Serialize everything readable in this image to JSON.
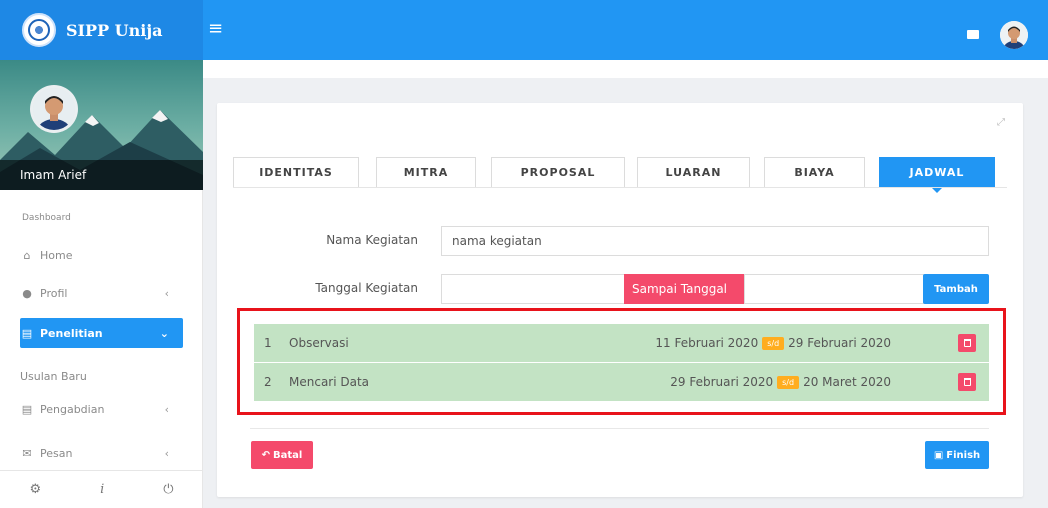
{
  "app": {
    "title": "SIPP Unija"
  },
  "topbar": {
    "menu_icon": "hamburger-icon",
    "mail_icon": "mail-icon",
    "avatar_icon": "user-avatar-icon"
  },
  "sidebar": {
    "user_name": "Imam Arief",
    "section": "Dashboard",
    "items": [
      {
        "label": "Home",
        "icon": "home-icon"
      },
      {
        "label": "Profil",
        "icon": "user-icon"
      },
      {
        "label": "Penelitian",
        "icon": "list-icon"
      },
      {
        "label": "Pengabdian",
        "icon": "list-icon"
      },
      {
        "label": "Pesan",
        "icon": "mail-icon"
      }
    ],
    "submenu": {
      "label": "Usulan Baru"
    },
    "footer": {
      "settings": "⚙",
      "info": "i",
      "power": "⏻"
    }
  },
  "tabs": [
    {
      "label": "IDENTITAS"
    },
    {
      "label": "MITRA"
    },
    {
      "label": "PROPOSAL"
    },
    {
      "label": "LUARAN"
    },
    {
      "label": "BIAYA"
    },
    {
      "label": "JADWAL"
    }
  ],
  "active_tab": "JADWAL",
  "form": {
    "nama_label": "Nama Kegiatan",
    "nama_placeholder": "nama kegiatan",
    "tanggal_label": "Tanggal Kegiatan",
    "sampai_label": "Sampai Tanggal",
    "tambah_label": "Tambah"
  },
  "schedule": [
    {
      "no": "1",
      "name": "Observasi",
      "start": "11 Februari 2020",
      "sep": "s/d",
      "end": "29 Februari 2020"
    },
    {
      "no": "2",
      "name": "Mencari Data",
      "start": "29 Februari 2020",
      "sep": "s/d",
      "end": "20 Maret 2020"
    }
  ],
  "actions": {
    "batal_label": "Batal",
    "finish_label": "Finish"
  },
  "colors": {
    "primary": "#2196f3",
    "danger": "#f44a6b",
    "success_row": "#c3e3c4",
    "warning": "#ffad1f",
    "highlight": "#e8131b"
  }
}
